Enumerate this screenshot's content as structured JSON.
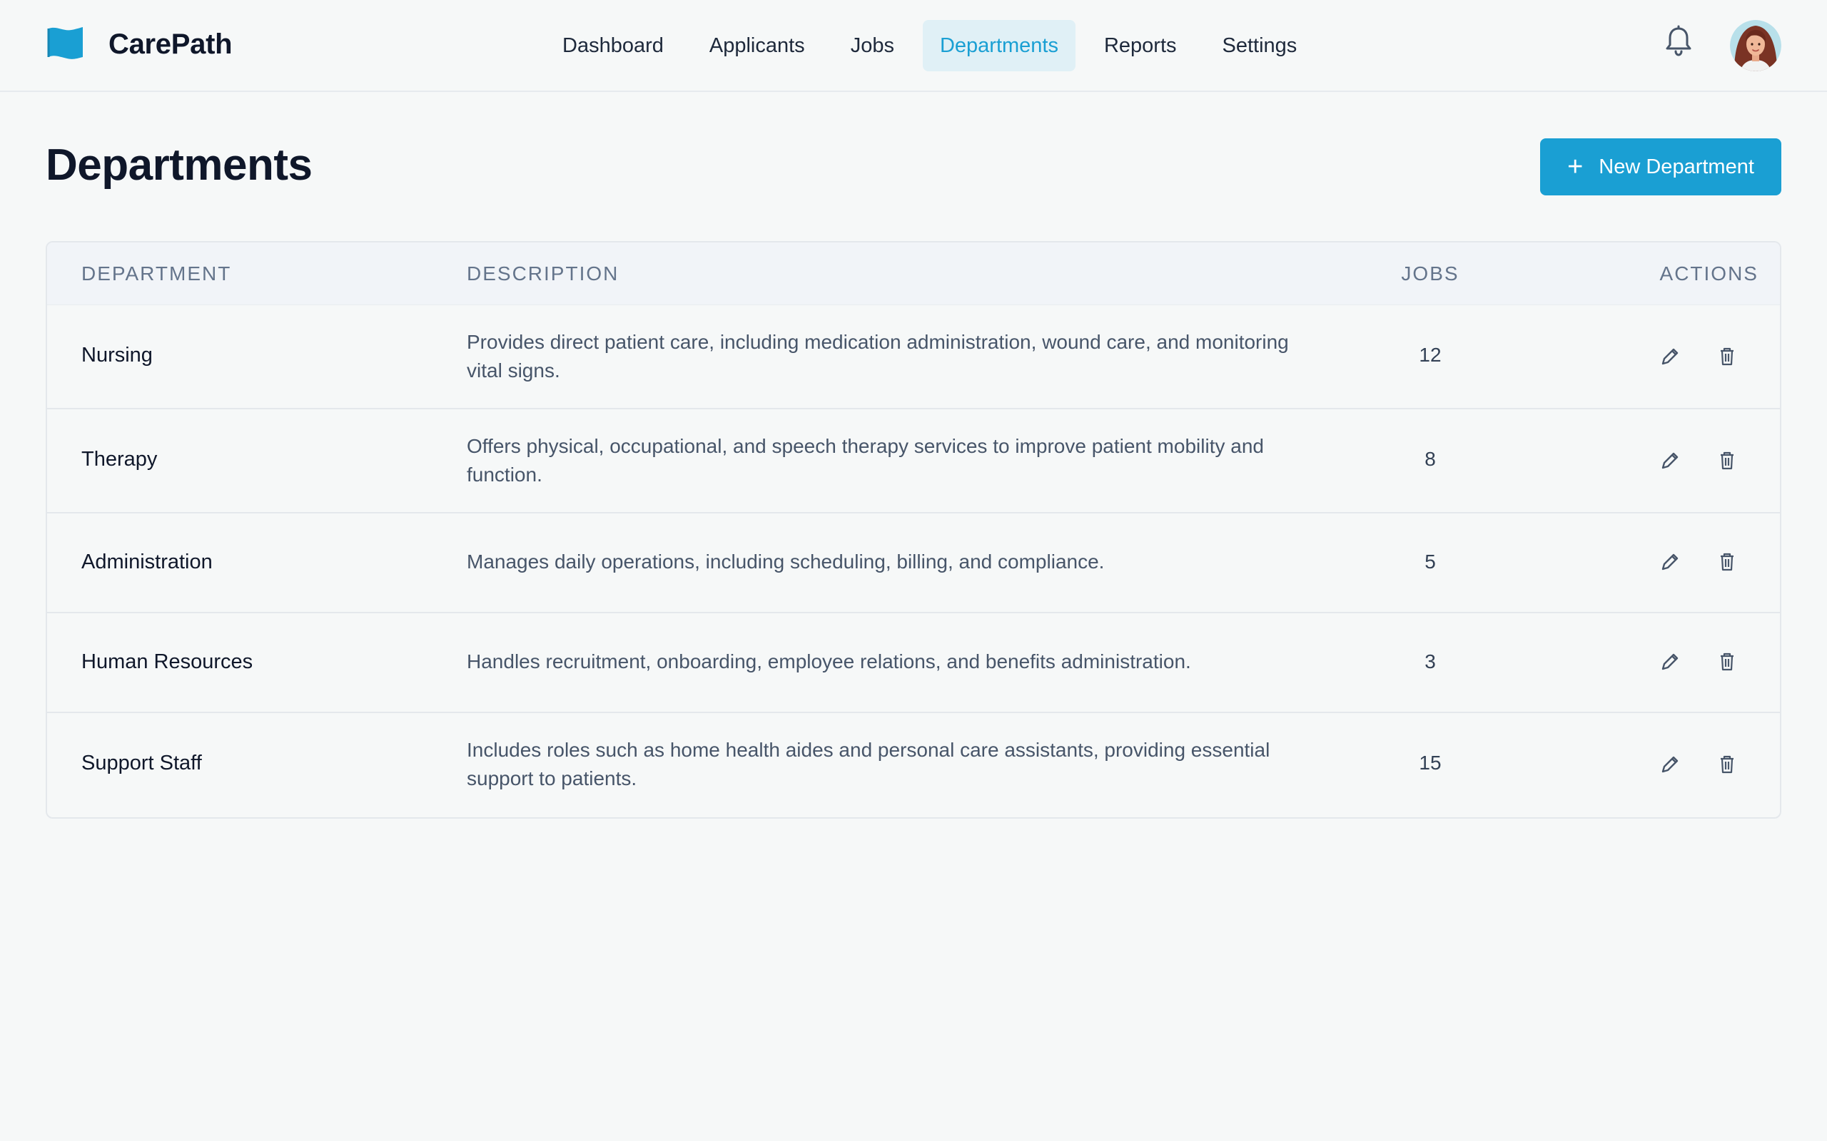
{
  "app": {
    "name": "CarePath",
    "brand_color": "#1a9fd3"
  },
  "nav": {
    "items": [
      {
        "label": "Dashboard",
        "active": false
      },
      {
        "label": "Applicants",
        "active": false
      },
      {
        "label": "Jobs",
        "active": false
      },
      {
        "label": "Departments",
        "active": true
      },
      {
        "label": "Reports",
        "active": false
      },
      {
        "label": "Settings",
        "active": false
      }
    ]
  },
  "header": {
    "bell_icon": "bell-icon",
    "avatar_icon": "user-avatar"
  },
  "page": {
    "title": "Departments",
    "new_button_label": "New Department"
  },
  "table": {
    "columns": [
      "DEPARTMENT",
      "DESCRIPTION",
      "JOBS",
      "ACTIONS"
    ],
    "rows": [
      {
        "name": "Nursing",
        "description": "Provides direct patient care, including medication administration, wound care, and monitoring vital signs.",
        "jobs": "12"
      },
      {
        "name": "Therapy",
        "description": "Offers physical, occupational, and speech therapy services to improve patient mobility and function.",
        "jobs": "8"
      },
      {
        "name": "Administration",
        "description": "Manages daily operations, including scheduling, billing, and compliance.",
        "jobs": "5"
      },
      {
        "name": "Human Resources",
        "description": "Handles recruitment, onboarding, employee relations, and benefits administration.",
        "jobs": "3"
      },
      {
        "name": "Support Staff",
        "description": "Includes roles such as home health aides and personal care assistants, providing essential support to patients.",
        "jobs": "15"
      }
    ],
    "row_actions": [
      "edit-icon",
      "trash-icon"
    ]
  }
}
